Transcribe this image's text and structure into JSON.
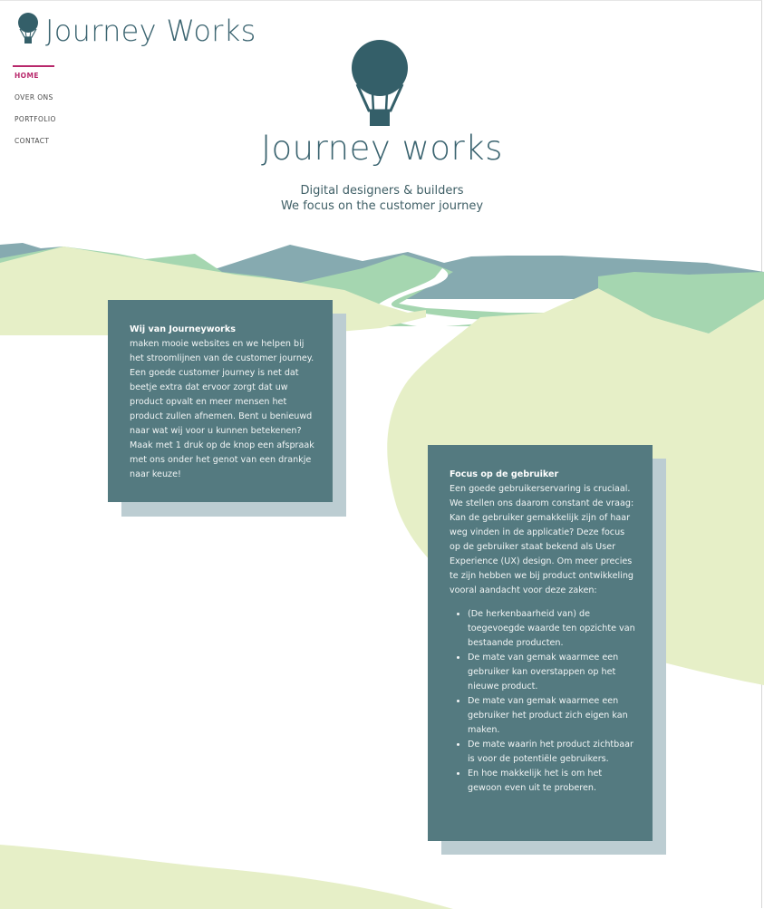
{
  "brand": {
    "name": "Journey Works",
    "icon": "hot-air-balloon-icon",
    "color": "#345f69"
  },
  "nav": {
    "items": [
      {
        "label": "HOME",
        "active": true
      },
      {
        "label": "OVER ONS",
        "active": false
      },
      {
        "label": "PORTFOLIO",
        "active": false
      },
      {
        "label": "CONTACT",
        "active": false
      }
    ],
    "accent": "#b8286b"
  },
  "hero": {
    "icon": "hot-air-balloon-icon",
    "title": "Journey works",
    "subtitle_line1": "Digital designers & builders",
    "subtitle_line2": "We focus on the customer journey"
  },
  "cards": {
    "about": {
      "title": "Wij van Journeyworks",
      "body": "maken mooie websites en we helpen bij het stroomlijnen van de customer journey. Een goede customer journey is net dat beetje extra dat ervoor zorgt dat uw product opvalt en meer mensen het product zullen afnemen. Bent u benieuwd naar wat wij voor u kunnen betekenen? Maak met 1 druk op de knop een afspraak met ons onder het genot van een drankje naar keuze!"
    },
    "focus": {
      "title": "Focus op de gebruiker",
      "body": "Een goede gebruikerservaring is cruciaal. We stellen ons daarom constant de vraag: Kan de gebruiker gemakkelijk zijn of haar weg vinden in de applicatie? Deze focus op de gebruiker staat bekend als User Experience (UX) design. Om meer precies te zijn hebben we bij product ontwikkeling vooral aandacht voor deze zaken:",
      "items": [
        "(De herkenbaarheid van) de toegevoegde waarde ten opzichte van bestaande producten.",
        "De mate van gemak waarmee een gebruiker kan overstappen op het nieuwe product.",
        "De mate van gemak waarmee een gebruiker het product zich eigen kan maken.",
        "De mate waarin het product zichtbaar is voor de potentiële gebruikers.",
        "En hoe makkelijk het is om het gewoon even uit te proberen."
      ]
    }
  },
  "colors": {
    "card_bg": "#547a80",
    "card_shadow": "#bccdd2",
    "mountain_far": "#86aab0",
    "mountain_mid": "#a5d6b0",
    "hill_light": "#e6efc7"
  }
}
